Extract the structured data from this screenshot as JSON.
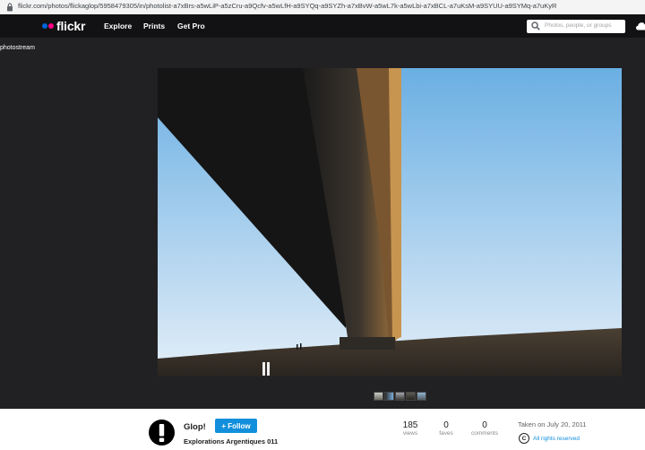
{
  "browser": {
    "url": "flickr.com/photos/flickaglop/5958479305/in/photolist-a7xBrs-a5wLiP-a5zCru-a9Qcfv-a5wLfH-a9SYQq-a9SYZh-a7xBvW-a5wL7k-a5wLbi-a7xBCL-a7uKsM-a9SYUU-a9SYMq-a7uKyR"
  },
  "nav": {
    "logo": "flickr",
    "items": [
      "Explore",
      "Prints",
      "Get Pro"
    ],
    "search_placeholder": "Photos, people, or groups"
  },
  "page": {
    "breadcrumb": "photostream"
  },
  "photo_info": {
    "author": "Glop!",
    "follow_label": "+ Follow",
    "title": "Explorations Argentiques 011",
    "views": "185",
    "views_label": "views",
    "faves": "0",
    "faves_label": "faves",
    "comments": "0",
    "comments_label": "comments",
    "taken": "Taken on July 20, 2011",
    "rights": "All rights reserved",
    "cc_symbol": "C"
  },
  "colors": {
    "brand_blue": "#0063dc",
    "brand_pink": "#ff0084",
    "follow_button": "#128fdc",
    "nav_bg": "#121214",
    "page_bg": "#212124"
  },
  "icons": {
    "lock": "lock-icon",
    "search": "search-icon",
    "upload": "upload-icon"
  }
}
